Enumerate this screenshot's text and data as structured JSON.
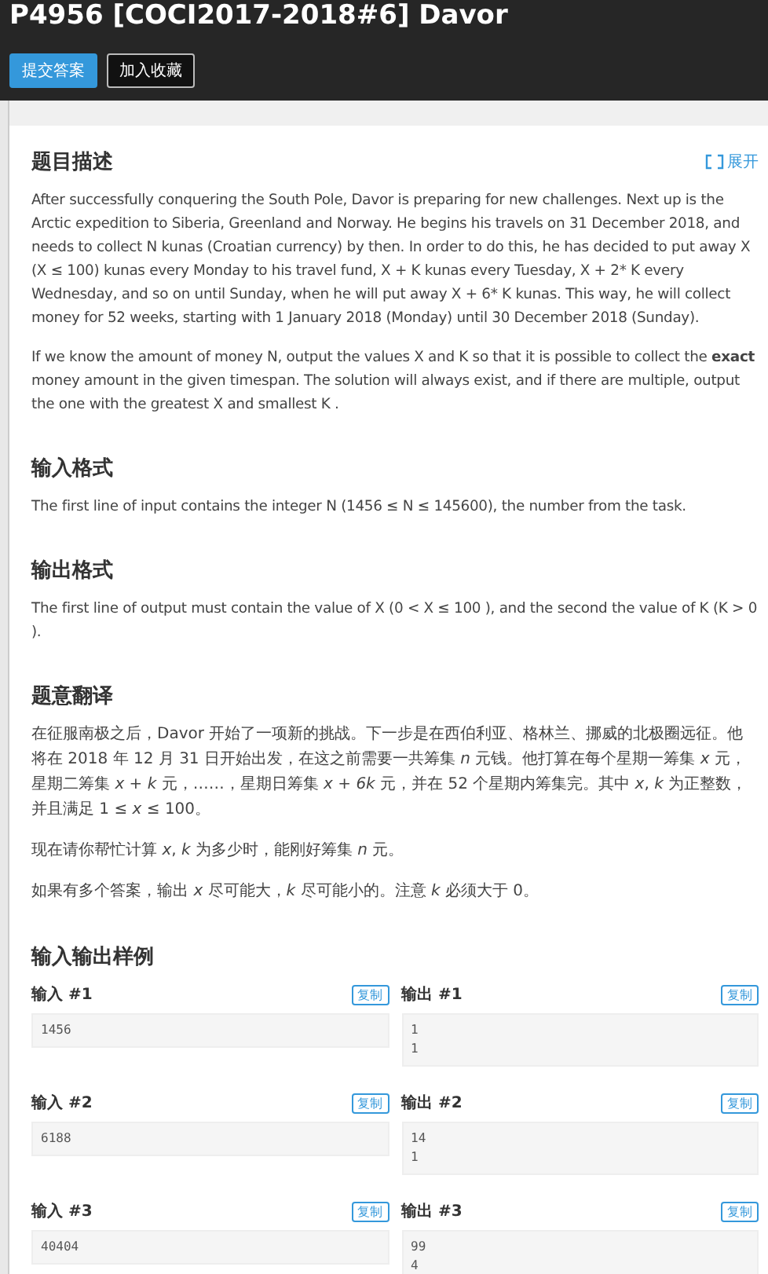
{
  "title": "P4956 [COCI2017-2018#6] Davor",
  "buttons": [
    {
      "label": "提交答案",
      "kind": "primary"
    },
    {
      "label": "加入收藏",
      "kind": "outline"
    }
  ],
  "sections": [
    {
      "heading": "题目描述",
      "action": "展开",
      "kind": "text",
      "paragraphs": [
        "After successfully conquering the South Pole, Davor is preparing for new challenges. Next up is the Arctic expedition to Siberia, Greenland and Norway. He begins his travels on 31 December 2018, and needs to collect N kunas (Croatian currency) by then. In order to do this, he has decided to put away X (X ≤ 100) kunas every Monday to his travel fund, X + K kunas every Tuesday, X + 2* K every Wednesday, and so on until Sunday, when he will put away X + 6* K kunas. This way, he will collect money for 52 weeks, starting with 1 January 2018 (Monday) until 30 December 2018 (Sunday).",
        "If we know the amount of money N, output the values X and K so that it is possible to collect the **exact** money amount in the given timespan. The solution will always exist, and if there are multiple, output the one with the greatest X  and smallest K ."
      ]
    },
    {
      "heading": "输入格式",
      "kind": "text",
      "paragraphs": [
        "The first line of input contains the integer N (1456 ≤ N ≤ 145600), the number from the task."
      ]
    },
    {
      "heading": "输出格式",
      "kind": "text",
      "paragraphs": [
        "The first line of output must contain the value of X (0 < X ≤ 100 ), and the second the value of K (K > 0 )."
      ]
    },
    {
      "heading": "题意翻译",
      "kind": "translation",
      "paragraphs": [
        "在征服南极之后，Davor 开始了一项新的挑战。下一步是在西伯利亚、格林兰、挪威的北极圈远征。他将在 2018 年 12 月 31 日开始出发，在这之前需要一共筹集 *n* 元钱。他打算在每个星期一筹集 *x* 元，星期二筹集 *x* + *k* 元，……，星期日筹集 *x* + *6k* 元，并在 52 个星期内筹集完。其中 *x*, *k* 为正整数，并且满足 1 ≤ *x* ≤ 100。",
        "现在请你帮忙计算 *x*, *k* 为多少时，能刚好筹集 *n* 元。",
        "如果有多个答案，输出 *x* 尽可能大，*k* 尽可能小的。注意 *k* 必须大于 0。"
      ]
    }
  ],
  "samples": {
    "heading": "输入输出样例",
    "pairs": [
      {
        "input": {
          "label": "输入 #1",
          "copy": "复制",
          "text": "1456"
        },
        "output": {
          "label": "输出 #1",
          "copy": "复制",
          "text": "1\n1"
        }
      },
      {
        "input": {
          "label": "输入 #2",
          "copy": "复制",
          "text": "6188"
        },
        "output": {
          "label": "输出 #2",
          "copy": "复制",
          "text": "14\n1"
        }
      },
      {
        "input": {
          "label": "输入 #3",
          "copy": "复制",
          "text": "40404"
        },
        "output": {
          "label": "输出 #3",
          "copy": "复制",
          "text": "99\n4"
        }
      }
    ]
  }
}
